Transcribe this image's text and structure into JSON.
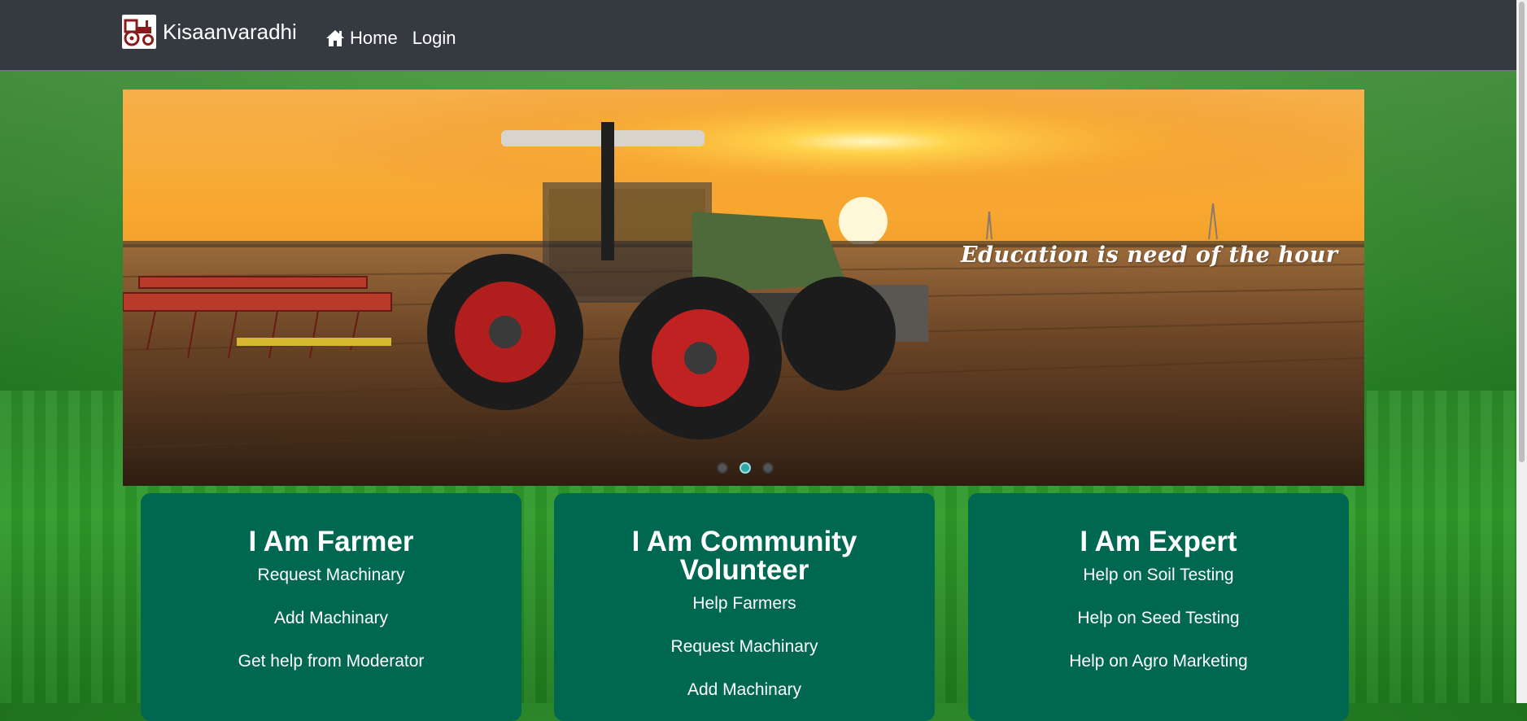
{
  "navbar": {
    "brand": "Kisaanvaradhi",
    "links": [
      {
        "label": "Home",
        "icon": "home-icon"
      },
      {
        "label": "Login"
      }
    ]
  },
  "carousel": {
    "caption": "Education is need of  the hour",
    "slide_count": 3,
    "active_index": 1
  },
  "cards": [
    {
      "title": "I Am Farmer",
      "links": [
        "Request Machinary",
        "Add Machinary",
        "Get help from Moderator"
      ]
    },
    {
      "title": "I Am Community Volunteer",
      "links": [
        "Help Farmers",
        "Request Machinary",
        "Add Machinary"
      ]
    },
    {
      "title": "I Am Expert",
      "links": [
        "Help on Soil Testing",
        "Help on Seed Testing",
        "Help on Agro Marketing"
      ]
    }
  ],
  "colors": {
    "navbar": "#343a40",
    "card": "#006750",
    "accent": "#2fa8a8"
  }
}
